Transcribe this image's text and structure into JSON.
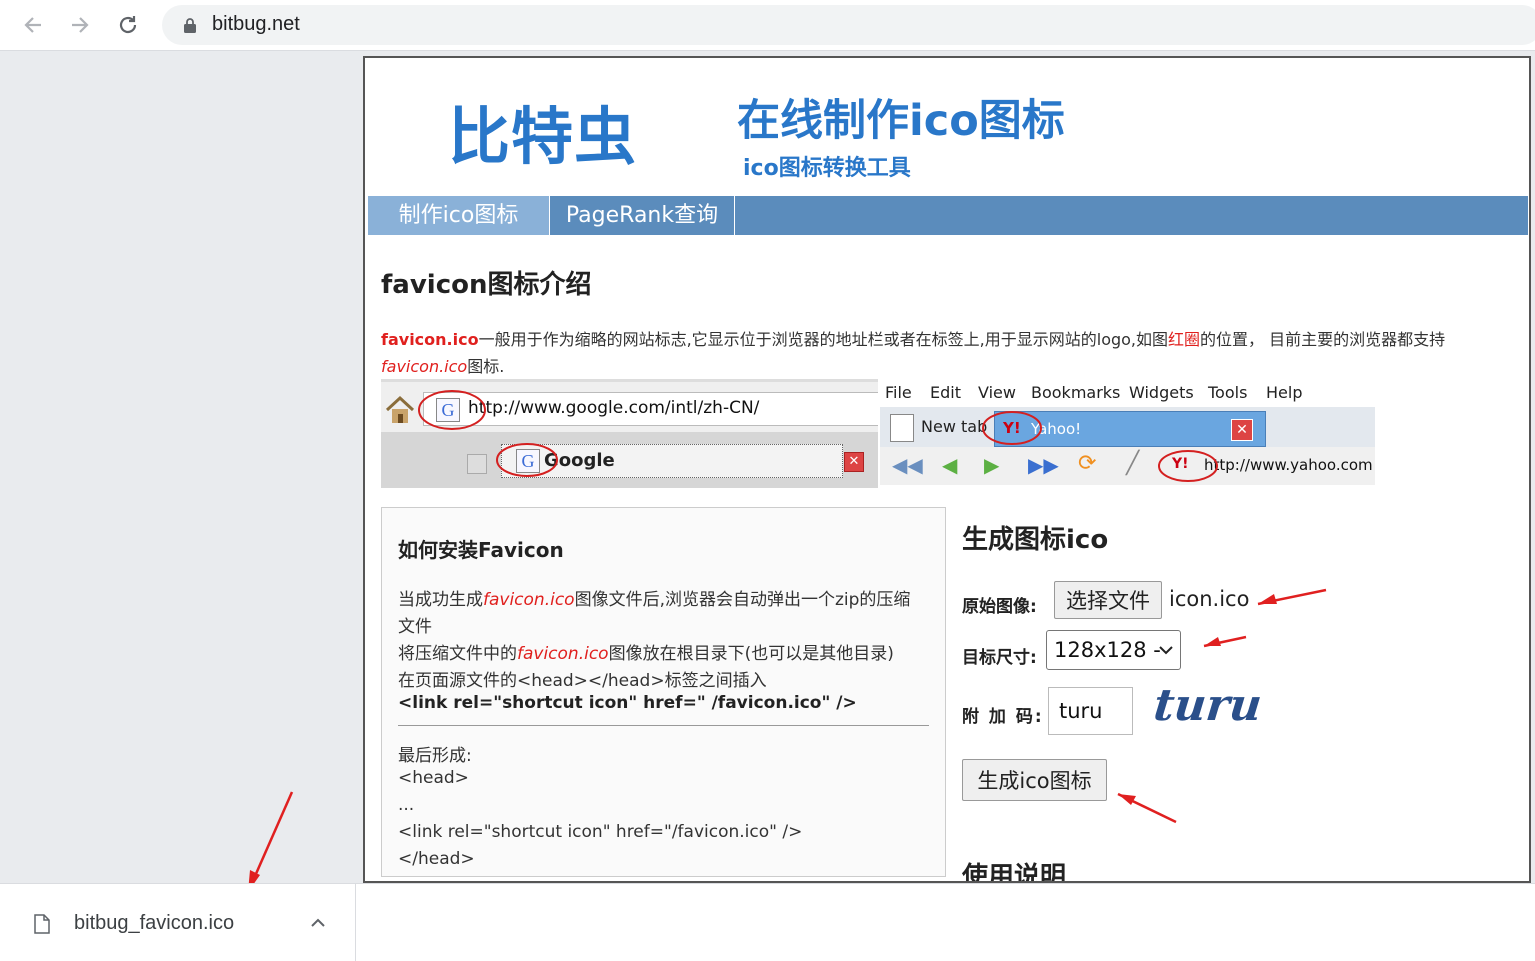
{
  "browser": {
    "url": "bitbug.net"
  },
  "site": {
    "logo": "比特虫",
    "headline": "在线制作ico图标",
    "subheadline": "ico图标转换工具",
    "nav": [
      {
        "label": "制作ico图标",
        "active": true
      },
      {
        "label": "PageRank查询",
        "active": false
      }
    ]
  },
  "intro": {
    "title": "favicon图标介绍",
    "text_1": "favicon.ico",
    "text_2": "一般用于作为缩略的网站标志,它显示位于浏览器的地址栏或者在标签上,用于显示网站的logo,如图",
    "text_3": "红圈",
    "text_4": "的位置， 目前主要的浏览器都支持",
    "text_5": "favicon.ico",
    "text_6": "图标."
  },
  "screenshot_left": {
    "url": "http://www.google.com/intl/zh-CN/",
    "tab": "Google"
  },
  "screenshot_right": {
    "menu": [
      "File",
      "Edit",
      "View",
      "Bookmarks",
      "Widgets",
      "Tools",
      "Help"
    ],
    "new_tab": "New tab",
    "tab": "Yahoo!",
    "url": "http://www.yahoo.com"
  },
  "install": {
    "title": "如何安装Favicon",
    "l1a": "当成功生成",
    "l1b": "favicon.ico",
    "l1c": "图像文件后,浏览器会自动弹出一个zip的压缩",
    "l2": "文件",
    "l3a": "将压缩文件中的",
    "l3b": "favicon.ico",
    "l3c": "图像放在根目录下(也可以是其他目录)",
    "l4": "在页面源文件的<head></head>标签之间插入",
    "l5": "<link rel=\"shortcut icon\" href=\" /favicon.ico\" />",
    "l6": "最后形成:",
    "l7": "<head>",
    "l8": "...",
    "l9": "<link rel=\"shortcut icon\" href=\"/favicon.ico\" />",
    "l10": "</head>"
  },
  "generator": {
    "title": "生成图标ico",
    "source_label": "原始图像:",
    "choose_file": "选择文件",
    "file_name": "icon.ico",
    "size_label": "目标尺寸:",
    "size_value": "128x128 -",
    "captcha_label": "附 加 码:",
    "captcha_value": "turu",
    "captcha_image_text": "turu",
    "submit": "生成ico图标",
    "usage_title": "使用说明"
  },
  "downloads": {
    "file": "bitbug_favicon.ico"
  },
  "colors": {
    "brand_blue": "#2977c9",
    "nav_bg": "#5b8cbc",
    "nav_active": "#8ab1d8",
    "accent_red": "#e0201e"
  }
}
